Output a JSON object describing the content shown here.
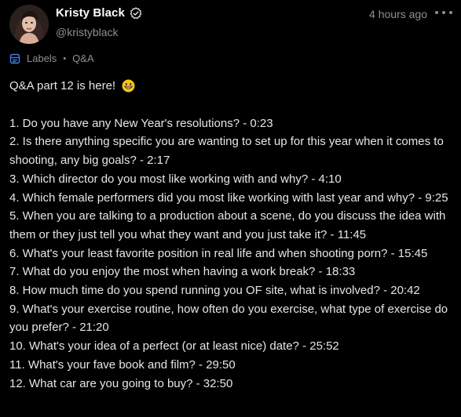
{
  "author": {
    "display_name": "Kristy Black",
    "handle": "@kristyblack"
  },
  "post": {
    "timestamp": "4 hours ago",
    "labels_label": "Labels",
    "label_tag": "Q&A",
    "title": "Q&A part 12 is here!",
    "emoji": "grinning-face-icon",
    "questions": [
      "1. Do you have any New Year's resolutions? - 0:23",
      "2. Is there anything specific you are wanting to set up for this year when it comes to shooting, any big goals? - 2:17",
      "3. Which director do you most like working with and why? - 4:10",
      "4. Which female performers did you most like working with last year and why? - 9:25",
      "5. When you are talking to a production about a scene, do you discuss the idea with them or they just tell you what they want and you just take it? - 11:45",
      "6. What's your least favorite position in real life and when shooting porn? - 15:45",
      "7. What do you enjoy the most when having a work break? - 18:33",
      "8. How much time do you spend running you OF site, what is involved? - 20:42",
      "9. What's your exercise routine, how often do you exercise, what type of exercise do you prefer? - 21:20",
      "10. What's your idea of a perfect (or at least nice) date? - 25:52",
      "11. What's your fave book and film? - 29:50",
      "12. What car are you going to buy? - 32:50"
    ]
  },
  "icons": {
    "verified": "verified-badge-icon",
    "more": "more-options-icon",
    "labels": "labels-icon"
  },
  "colors": {
    "background": "#000000",
    "text": "#e6e6e6",
    "muted": "#8f8f8f",
    "labels_icon": "#3b82f6",
    "emoji": "#f5c518"
  }
}
